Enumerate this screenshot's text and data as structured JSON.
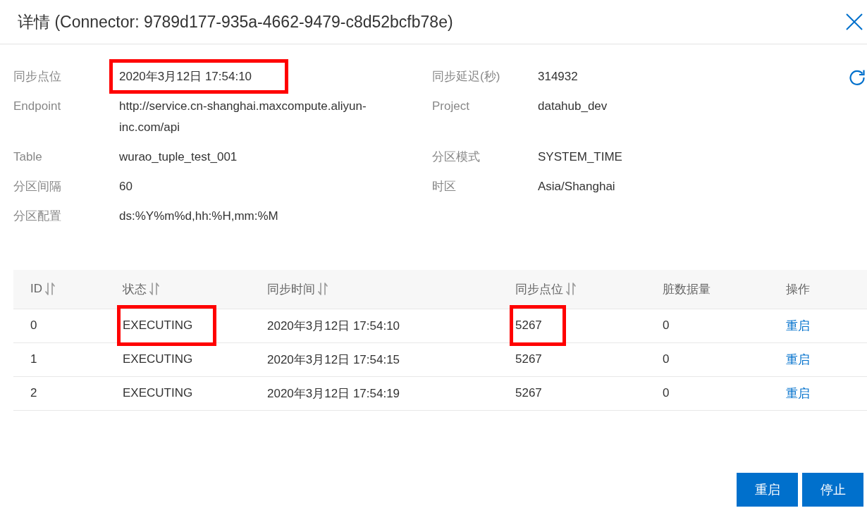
{
  "dialog": {
    "title": "详情 (Connector: 9789d177-935a-4662-9479-c8d52bcfb78e)"
  },
  "details": [
    {
      "label": "同步点位",
      "value": "2020年3月12日 17:54:10",
      "highlighted": true
    },
    {
      "label": "同步延迟(秒)",
      "value": "314932",
      "highlighted": false
    },
    {
      "label": "Endpoint",
      "value": "http://service.cn-shanghai.maxcompute.aliyun-inc.com/api",
      "highlighted": false
    },
    {
      "label": "Project",
      "value": "datahub_dev",
      "highlighted": false
    },
    {
      "label": "Table",
      "value": "wurao_tuple_test_001",
      "highlighted": false
    },
    {
      "label": "分区模式",
      "value": "SYSTEM_TIME",
      "highlighted": false
    },
    {
      "label": "分区间隔",
      "value": "60",
      "highlighted": false
    },
    {
      "label": "时区",
      "value": "Asia/Shanghai",
      "highlighted": false
    },
    {
      "label": "分区配置",
      "value": "ds:%Y%m%d,hh:%H,mm:%M",
      "highlighted": false
    }
  ],
  "table": {
    "columns": [
      {
        "label": "ID",
        "sortable": true
      },
      {
        "label": "状态",
        "sortable": true
      },
      {
        "label": "同步时间",
        "sortable": true
      },
      {
        "label": "同步点位",
        "sortable": true
      },
      {
        "label": "脏数据量",
        "sortable": false
      },
      {
        "label": "操作",
        "sortable": false
      }
    ],
    "rows": [
      {
        "cells": [
          {
            "text": "0",
            "highlighted": false
          },
          {
            "text": "EXECUTING",
            "highlighted": true
          },
          {
            "text": "2020年3月12日 17:54:10",
            "highlighted": false
          },
          {
            "text": "5267",
            "highlighted": true
          },
          {
            "text": "0",
            "highlighted": false
          }
        ],
        "action": "重启"
      },
      {
        "cells": [
          {
            "text": "1",
            "highlighted": false
          },
          {
            "text": "EXECUTING",
            "highlighted": false
          },
          {
            "text": "2020年3月12日 17:54:15",
            "highlighted": false
          },
          {
            "text": "5267",
            "highlighted": false
          },
          {
            "text": "0",
            "highlighted": false
          }
        ],
        "action": "重启"
      },
      {
        "cells": [
          {
            "text": "2",
            "highlighted": false
          },
          {
            "text": "EXECUTING",
            "highlighted": false
          },
          {
            "text": "2020年3月12日 17:54:19",
            "highlighted": false
          },
          {
            "text": "5267",
            "highlighted": false
          },
          {
            "text": "0",
            "highlighted": false
          }
        ],
        "action": "重启"
      }
    ]
  },
  "footer": {
    "buttons": [
      {
        "label": "重启"
      },
      {
        "label": "停止"
      }
    ]
  }
}
